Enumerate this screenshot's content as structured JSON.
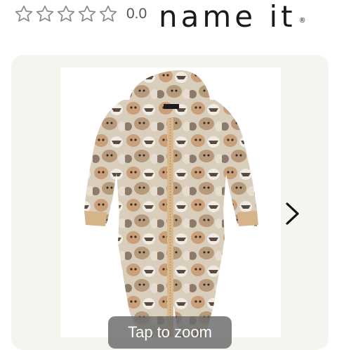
{
  "rating": {
    "stars": [
      0,
      0,
      0,
      0,
      0
    ],
    "value": "0.0",
    "star_color": "#888888",
    "star_icon": "star-outline-icon"
  },
  "brand": {
    "name": "name it",
    "mark": "®",
    "color": "#1b1b1b"
  },
  "gallery": {
    "image_alt": "",
    "next_icon": "chevron-right-icon",
    "zoom_label": "Tap to zoom",
    "card_color": "#f6f4ef"
  }
}
